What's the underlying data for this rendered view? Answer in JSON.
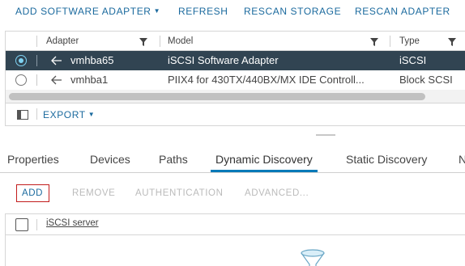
{
  "toolbar": {
    "add_software_adapter": "ADD SOFTWARE ADAPTER",
    "refresh": "REFRESH",
    "rescan_storage": "RESCAN STORAGE",
    "rescan_adapter": "RESCAN ADAPTER"
  },
  "adapter_grid": {
    "columns": [
      "Adapter",
      "Model",
      "Type"
    ],
    "rows": [
      {
        "adapter": "vmhba65",
        "model": "iSCSI Software Adapter",
        "type": "iSCSI",
        "selected": true
      },
      {
        "adapter": "vmhba1",
        "model": "PIIX4 for 430TX/440BX/MX IDE Controll...",
        "type": "Block SCSI",
        "selected": false
      }
    ],
    "export_label": "EXPORT"
  },
  "detail_tabs": [
    "Properties",
    "Devices",
    "Paths",
    "Dynamic Discovery",
    "Static Discovery",
    "N"
  ],
  "active_tab": "Dynamic Discovery",
  "actions": {
    "add": "ADD",
    "remove": "REMOVE",
    "authentication": "AUTHENTICATION",
    "advanced": "ADVANCED..."
  },
  "server_grid": {
    "column": "iSCSI server"
  },
  "colors": {
    "accent": "#0079b8",
    "link": "#1b6a9e",
    "selected_row": "#314452",
    "highlight_box": "#c21d1d"
  }
}
